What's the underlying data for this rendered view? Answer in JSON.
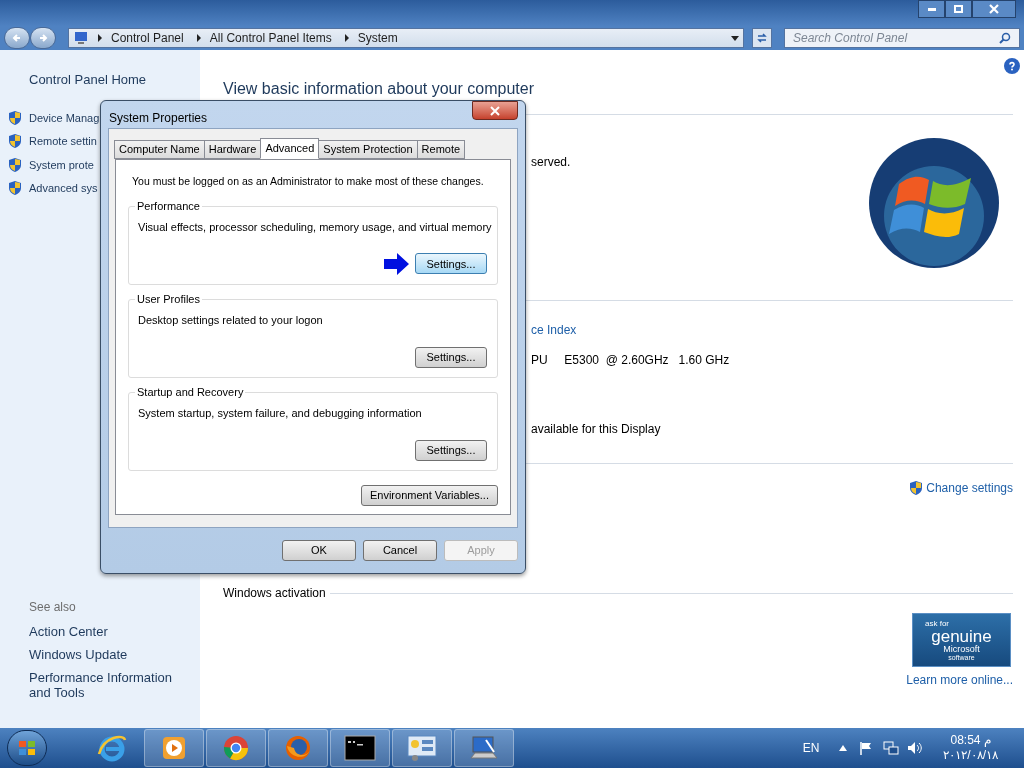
{
  "window": {
    "breadcrumb": [
      "Control Panel",
      "All Control Panel Items",
      "System"
    ],
    "search": {
      "placeholder": "Search Control Panel"
    }
  },
  "sidebar": {
    "home": "Control Panel Home",
    "tasks": [
      "Device Manag",
      "Remote settin",
      "System prote",
      "Advanced sys"
    ],
    "see_also_title": "See also",
    "see_also": [
      "Action Center",
      "Windows Update",
      "Performance Information and Tools"
    ]
  },
  "content": {
    "heading": "View basic information about your computer",
    "copyright_tail": "served.",
    "rating_link": "ce Index",
    "processor": "PU     E5300  @ 2.60GHz   1.60 GHz",
    "pen_touch": "available for this Display",
    "change_settings": "Change settings",
    "activation_title": "Windows activation",
    "genuine_badge": [
      "ask for",
      "genuine",
      "Microsoft",
      "software"
    ],
    "learn_more": "Learn more online..."
  },
  "dialog": {
    "title": "System Properties",
    "tabs": [
      {
        "label": "Computer Name",
        "selected": false
      },
      {
        "label": "Hardware",
        "selected": false
      },
      {
        "label": "Advanced",
        "selected": true
      },
      {
        "label": "System Protection",
        "selected": false
      },
      {
        "label": "Remote",
        "selected": false
      }
    ],
    "notice": "You must be logged on as an Administrator to make most of these changes.",
    "groups": [
      {
        "title": "Performance",
        "description": "Visual effects, processor scheduling, memory usage, and virtual memory",
        "button": "Settings...",
        "highlighted": true
      },
      {
        "title": "User Profiles",
        "description": "Desktop settings related to your logon",
        "button": "Settings...",
        "highlighted": false
      },
      {
        "title": "Startup and Recovery",
        "description": "System startup, system failure, and debugging information",
        "button": "Settings...",
        "highlighted": false
      }
    ],
    "env_button": "Environment Variables...",
    "buttons": [
      {
        "label": "OK",
        "disabled": false
      },
      {
        "label": "Cancel",
        "disabled": false
      },
      {
        "label": "Apply",
        "disabled": true
      }
    ]
  },
  "taskbar": {
    "apps": [
      {
        "kind": "ie",
        "active": false
      },
      {
        "kind": "media",
        "active": true
      },
      {
        "kind": "chrome",
        "active": true
      },
      {
        "kind": "firefox",
        "active": true
      },
      {
        "kind": "cmd",
        "active": true
      },
      {
        "kind": "panel",
        "active": true
      },
      {
        "kind": "system",
        "active": true
      }
    ],
    "language": "EN",
    "time": "08:54 م",
    "date": "٢٠١٢/٠٨/١٨"
  }
}
